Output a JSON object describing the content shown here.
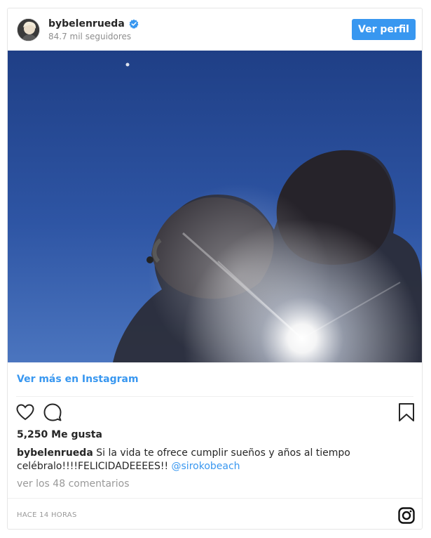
{
  "post": {
    "username": "bybelenrueda",
    "followers": "84.7 mil seguidores",
    "view_profile_label": "Ver perfil",
    "view_more_label": "Ver más en Instagram",
    "likes": "5,250 Me gusta",
    "caption_user": "bybelenrueda",
    "caption_text": "Si la vida te ofrece cumplir sueños y años al tiempo celébralo!!!!FELICIDADEEEES!!",
    "caption_mention": "@sirokobeach",
    "comments_label": "ver los 48 comentarios",
    "timestamp": "HACE 14 HORAS"
  },
  "icons": {
    "verified": "verified-badge-icon",
    "like": "heart-icon",
    "comment": "comment-icon",
    "save": "bookmark-icon",
    "brand": "instagram-icon"
  },
  "colors": {
    "accent": "#3897f0",
    "text": "#262626",
    "muted": "#8e8e8e",
    "border": "#e6e6e6",
    "sky": "#2d4f9a"
  }
}
